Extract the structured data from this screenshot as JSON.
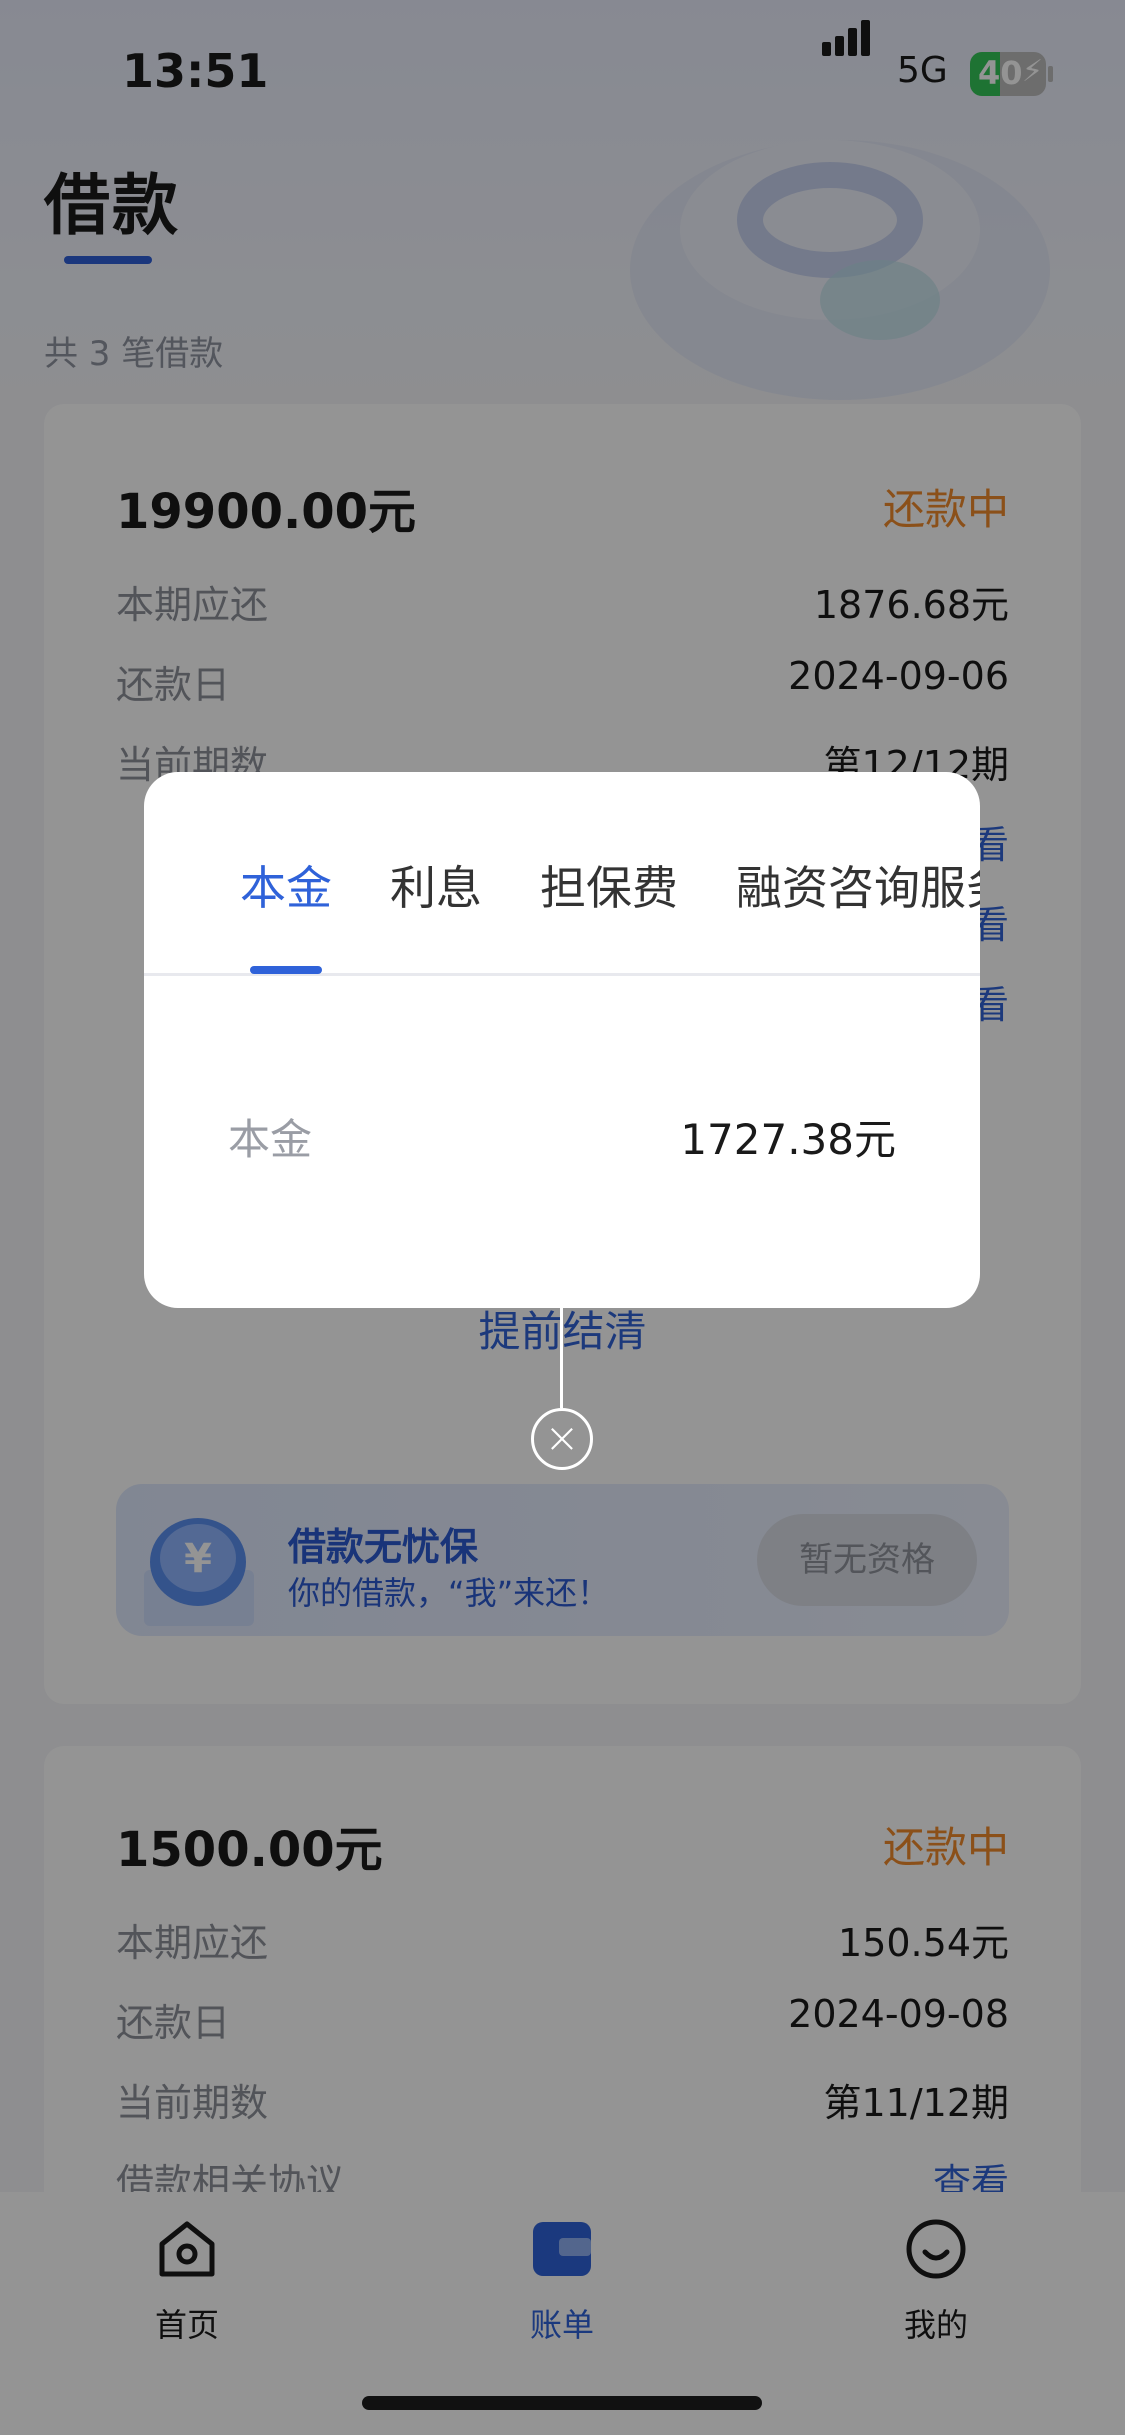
{
  "status_bar": {
    "time": "13:51",
    "network": "5G",
    "battery": "40",
    "battery_level": 0.4
  },
  "header": {
    "title": "借款",
    "loan_count": "共 3 笔借款"
  },
  "loans": [
    {
      "amount": "19900.00元",
      "status": "还款中",
      "rows": [
        {
          "label": "本期应还",
          "value": "1876.68元"
        },
        {
          "label": "还款日",
          "value": "2024-09-06"
        },
        {
          "label": "当前期数",
          "value": "第12/12期"
        }
      ],
      "links": [
        "查看",
        "查看",
        "查看"
      ],
      "early_settle": "提前结清",
      "promo": {
        "title": "借款无忧保",
        "subtitle": "你的借款，“我”来还！",
        "button": "暂无资格"
      }
    },
    {
      "amount": "1500.00元",
      "status": "还款中",
      "rows": [
        {
          "label": "本期应还",
          "value": "150.54元"
        },
        {
          "label": "还款日",
          "value": "2024-09-08"
        },
        {
          "label": "当前期数",
          "value": "第11/12期"
        },
        {
          "label": "借款相关协议",
          "value": "查看"
        }
      ]
    }
  ],
  "modal": {
    "tabs": [
      "本金",
      "利息",
      "担保费",
      "融资咨询服务费"
    ],
    "active_tab": "本金",
    "detail_label": "本金",
    "detail_value": "1727.38元"
  },
  "bottom_nav": [
    {
      "label": "首页",
      "icon": "home-icon",
      "active": false
    },
    {
      "label": "账单",
      "icon": "bill-icon",
      "active": true
    },
    {
      "label": "我的",
      "icon": "profile-icon",
      "active": false
    }
  ],
  "colors": {
    "accent": "#2f62d9",
    "status_orange": "#f08a2b"
  }
}
